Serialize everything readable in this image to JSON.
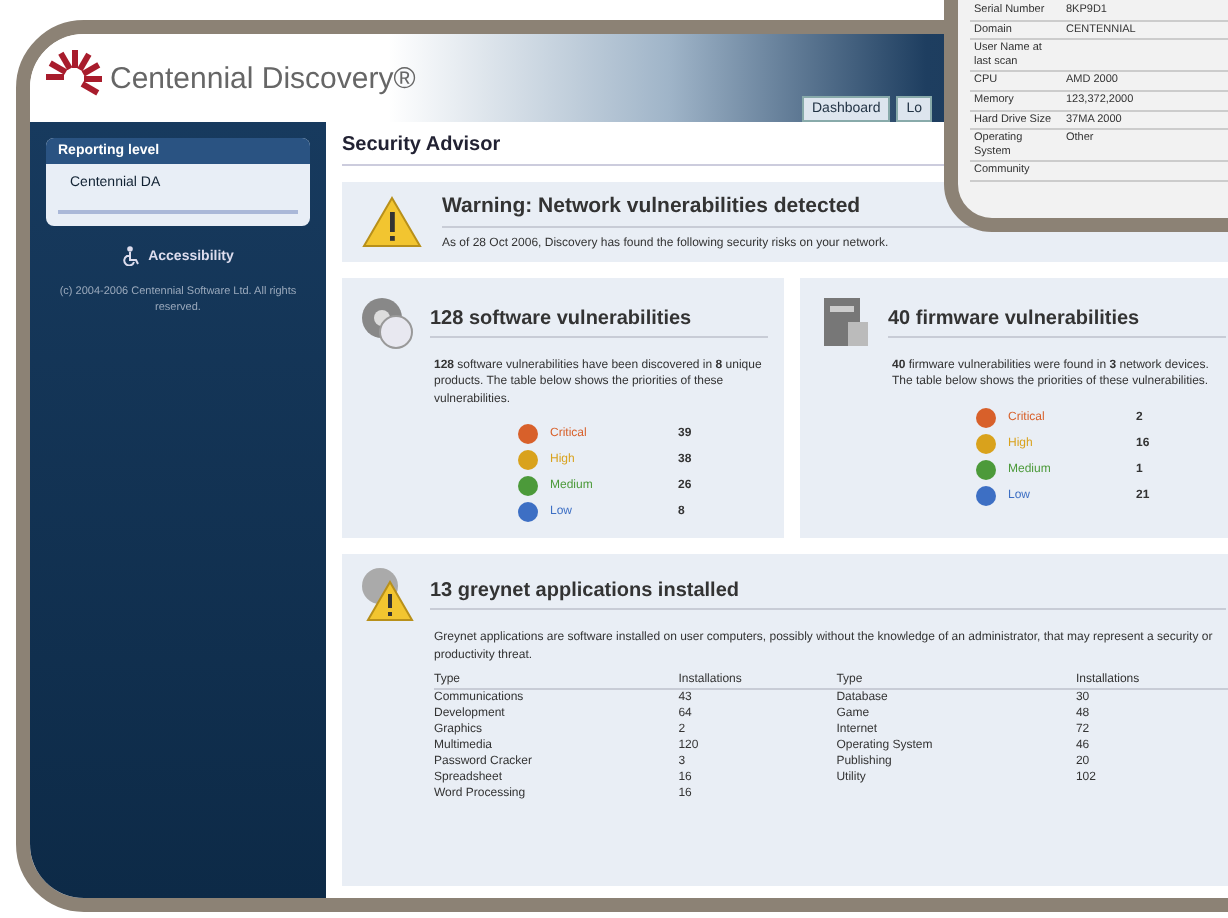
{
  "header": {
    "logo": "Centennial Discovery®",
    "tabs": [
      {
        "label": "Dashboard",
        "selected": false
      },
      {
        "label": "Lo",
        "selected": false
      }
    ]
  },
  "sidebar": {
    "heading": "Reporting level",
    "items": [
      {
        "label": "Centennial DA",
        "selected": true
      }
    ],
    "accessibility": "Accessibility",
    "copyright": "(c) 2004-2006 Centennial Software Ltd. All rights reserved."
  },
  "page_title": "Security Advisor",
  "warning": {
    "title": "Warning: Network vulnerabilities detected",
    "text": "As of 28 Oct 2006, Discovery has found the following security risks on your network."
  },
  "panels": [
    {
      "kind": "software",
      "title": "128 software vulnerabilities",
      "text": "**128** software vulnerabilities have been discovered in **8** unique products. The table below shows the priorities of these vulnerabilities.",
      "rows": [
        {
          "label": "Critical",
          "count": "39",
          "color": "#d8602a"
        },
        {
          "label": "High",
          "count": "38",
          "color": "#d9a21c"
        },
        {
          "label": "Medium",
          "count": "26",
          "color": "#4c9a3a"
        },
        {
          "label": "Low",
          "count": "8",
          "color": "#3d6fc4"
        }
      ]
    },
    {
      "kind": "firmware",
      "title": "40 firmware vulnerabilities",
      "text": "**40** firmware vulnerabilities were found in **3** network devices. The table below shows the priorities of these vulnerabilities.",
      "rows": [
        {
          "label": "Critical",
          "count": "2",
          "color": "#d8602a"
        },
        {
          "label": "High",
          "count": "16",
          "color": "#d9a21c"
        },
        {
          "label": "Medium",
          "count": "1",
          "color": "#4c9a3a"
        },
        {
          "label": "Low",
          "count": "21",
          "color": "#3d6fc4"
        }
      ]
    }
  ],
  "greynet": {
    "title": "13 greynet applications installed",
    "text": "Greynet applications are software installed on user computers, possibly without the knowledge of an administrator, that may represent a security or productivity threat.",
    "columns": [
      "Type",
      "Installations",
      "Type",
      "Installations"
    ],
    "rows": [
      [
        "Communications",
        "43",
        "Database",
        "30"
      ],
      [
        "Development",
        "64",
        "Game",
        "48"
      ],
      [
        "Graphics",
        "2",
        "Internet",
        "72"
      ],
      [
        "Multimedia",
        "120",
        "Operating System",
        "46"
      ],
      [
        "Password Cracker",
        "3",
        "Publishing",
        "20"
      ],
      [
        "Spreadsheet",
        "16",
        "Utility",
        "102"
      ],
      [
        "Word Processing",
        "16",
        "",
        ""
      ]
    ]
  },
  "inset": {
    "rows": [
      {
        "label": "Serial Number",
        "value": "8KP9D1"
      },
      {
        "label": "Domain",
        "value": "CENTENNIAL"
      },
      {
        "label": "User Name at last scan",
        "value": ""
      },
      {
        "label": "CPU",
        "value": "AMD 2000"
      },
      {
        "label": "Memory",
        "value": "123,372,2000"
      },
      {
        "label": "Hard Drive Size",
        "value": "37MA 2000"
      },
      {
        "label": "Operating System",
        "value": "Other"
      },
      {
        "label": "Community",
        "value": ""
      }
    ]
  }
}
